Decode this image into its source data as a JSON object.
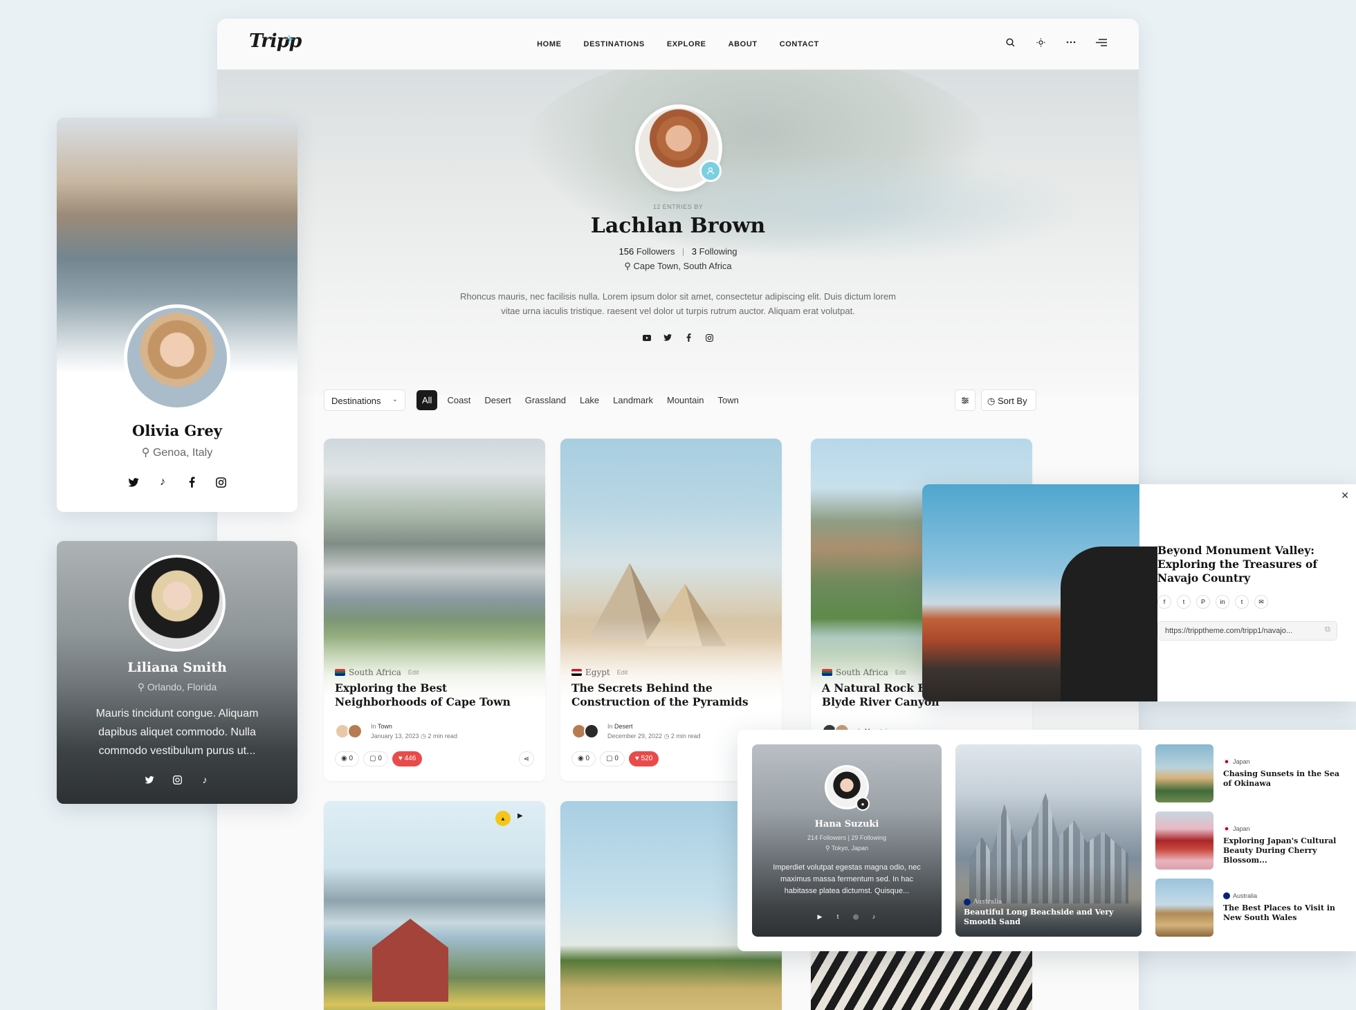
{
  "site": {
    "logo": "Tripp",
    "nav": [
      "HOME",
      "DESTINATIONS",
      "EXPLORE",
      "ABOUT",
      "CONTACT"
    ],
    "tools": [
      "search-icon",
      "sun-icon",
      "more-icon",
      "menu-icon"
    ]
  },
  "author": {
    "entries": "12 ENTRIES BY",
    "name": "Lachlan Brown",
    "followers_count": "156",
    "followers_label": "Followers",
    "following_count": "3",
    "following_label": "Following",
    "location": "Cape Town, South Africa",
    "bio": "Rhoncus mauris, nec facilisis nulla. Lorem ipsum dolor sit amet, consectetur adipiscing elit. Duis dictum lorem vitae urna iaculis tristique. raesent vel dolor ut turpis rutrum auctor. Aliquam erat volutpat.",
    "socials": [
      "youtube-icon",
      "twitter-icon",
      "facebook-icon",
      "instagram-icon"
    ]
  },
  "filters": {
    "dropdown": "Destinations",
    "chips": [
      "All",
      "Coast",
      "Desert",
      "Grassland",
      "Lake",
      "Landmark",
      "Mountain",
      "Town"
    ],
    "active_chip": "All",
    "sort_label": "Sort By"
  },
  "posts": [
    {
      "country": "South Africa",
      "edit": "Edit",
      "title": "Exploring the Best Neighborhoods of Cape Town",
      "category_prefix": "In",
      "category": "Town",
      "date": "January 13, 2023",
      "read": "2 min read",
      "views": "0",
      "comments": "0",
      "likes": "446"
    },
    {
      "country": "Egypt",
      "edit": "Edit",
      "title": "The Secrets Behind the Construction of the Pyramids",
      "category_prefix": "In",
      "category": "Desert",
      "date": "December 29, 2022",
      "read": "2 min read",
      "views": "0",
      "comments": "0",
      "likes": "520"
    },
    {
      "country": "South Africa",
      "edit": "Edit",
      "title": "A Natural Rock For Edge of The Blyde River Canyon",
      "category_prefix": "In",
      "category": "Mountain"
    }
  ],
  "profile_cards": {
    "olivia": {
      "name": "Olivia Grey",
      "location": "Genoa, Italy",
      "socials": [
        "twitter-icon",
        "tiktok-icon",
        "facebook-icon",
        "instagram-icon"
      ]
    },
    "liliana": {
      "name": "Liliana Smith",
      "location": "Orlando, Florida",
      "bio": "Mauris tincidunt congue. Aliquam dapibus aliquet commodo. Nulla commodo vestibulum purus ut...",
      "socials": [
        "twitter-icon",
        "instagram-icon",
        "tiktok-icon"
      ]
    }
  },
  "share_popup": {
    "title": "Beyond Monument Valley: Exploring the Treasures of Navajo Country",
    "url": "https://tripptheme.com/tripp1/navajo...",
    "socials": [
      "facebook-icon",
      "twitter-icon",
      "pinterest-icon",
      "linkedin-icon",
      "tumblr-icon",
      "email-icon"
    ]
  },
  "widgets": {
    "hana": {
      "name": "Hana Suzuki",
      "followers": "214 Followers",
      "following": "29 Following",
      "location": "Tokyo, Japan",
      "bio": "Imperdiet volutpat egestas magna odio, nec maximus massa fermentum sed. In hac habitasse platea dictumst. Quisque..."
    },
    "featured": {
      "country": "Australia",
      "title": "Beautiful Long Beachside and Very Smooth Sand"
    },
    "list": [
      {
        "country": "Japan",
        "title": "Chasing Sunsets in the Sea of Okinawa"
      },
      {
        "country": "Japan",
        "title": "Exploring Japan's Cultural Beauty During Cherry Blossom..."
      },
      {
        "country": "Australia",
        "title": "The Best Places to Visit in New South Wales"
      }
    ]
  },
  "colors": {
    "accent": "#7ccfe0",
    "heart": "#e94b4b",
    "active_chip": "#1a1a1a"
  }
}
